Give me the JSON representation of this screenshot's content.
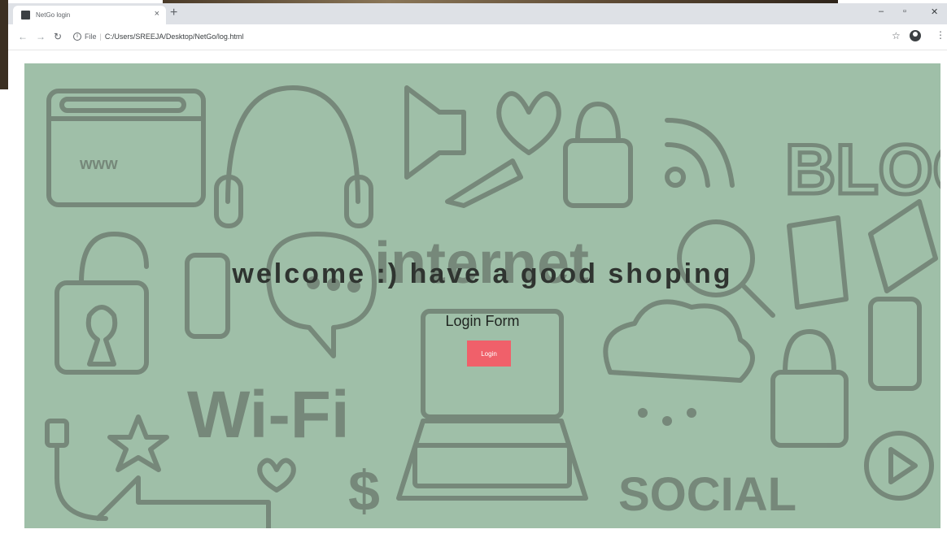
{
  "browser": {
    "tab_title": "NetGo login",
    "close_glyph": "×",
    "newtab_glyph": "+",
    "address_chip": "File",
    "address_sep": "|",
    "url": "C:/Users/SREEJA/Desktop/NetGo/log.html",
    "icons": [
      "favicon-icon",
      "close-icon",
      "new-tab-icon",
      "back-icon",
      "forward-icon",
      "reload-icon",
      "info-icon",
      "star-icon",
      "profile-icon",
      "menu-icon",
      "minimize-icon",
      "maximize-icon",
      "close-window-icon"
    ]
  },
  "page": {
    "headline": "welcome :) have a good shoping",
    "form_title": "Login Form",
    "login_label": "Login",
    "doodle_words": [
      "www",
      "BLOG",
      "internet",
      "Wi-Fi",
      "SOCIAL",
      "$"
    ],
    "colors": {
      "background": "#9fbfa8",
      "doodle": "#6f7f72",
      "login_button": "#f0606a",
      "headline": "#2f3430"
    }
  }
}
